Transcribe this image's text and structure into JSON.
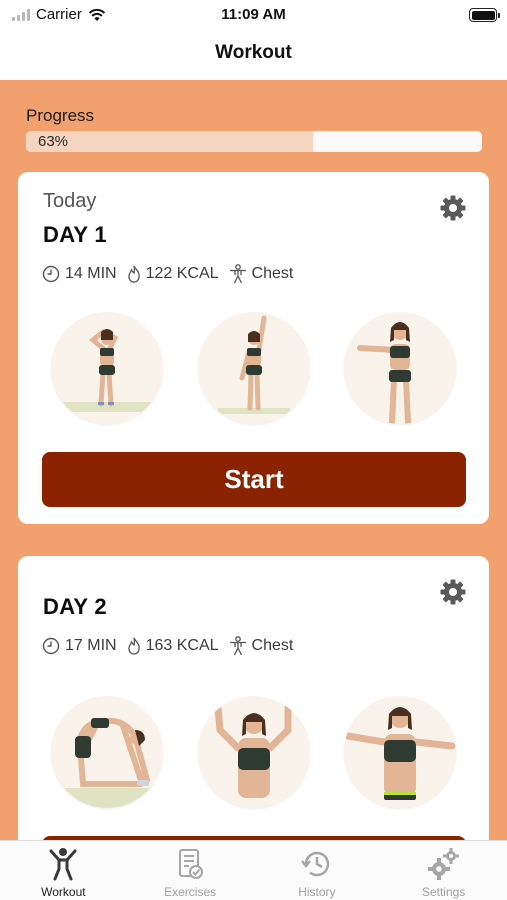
{
  "status_bar": {
    "carrier": "Carrier",
    "time": "11:09 AM"
  },
  "nav": {
    "title": "Workout"
  },
  "progress": {
    "label": "Progress",
    "percent_text": "63%",
    "value": 0.63
  },
  "colors": {
    "background": "#f2a06e",
    "button": "#8b2200",
    "progress_fill": "#f5d5bf"
  },
  "workouts": [
    {
      "subtitle": "Today",
      "day": "DAY 1",
      "duration": "14 MIN",
      "calories": "122 KCAL",
      "focus": "Chest",
      "exercises": [
        "overhead-stretch",
        "arm-raise",
        "shoulder-stretch"
      ],
      "button": "Start"
    },
    {
      "subtitle": "",
      "day": "DAY 2",
      "duration": "17 MIN",
      "calories": "163 KCAL",
      "focus": "Chest",
      "exercises": [
        "kneeling-backbend",
        "arms-up-bend",
        "arms-out-twist"
      ]
    }
  ],
  "tabs": [
    {
      "label": "Workout",
      "icon": "person-icon",
      "active": true
    },
    {
      "label": "Exercises",
      "icon": "checklist-icon",
      "active": false
    },
    {
      "label": "History",
      "icon": "history-icon",
      "active": false
    },
    {
      "label": "Settings",
      "icon": "gears-icon",
      "active": false
    }
  ]
}
